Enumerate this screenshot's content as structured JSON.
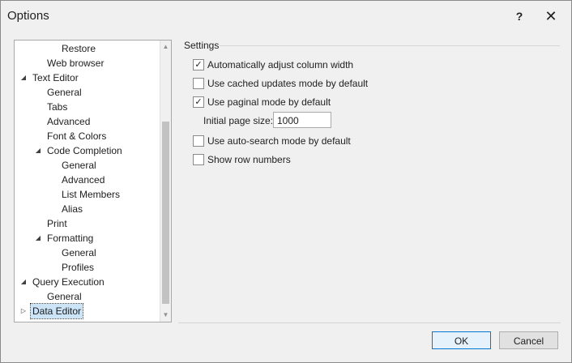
{
  "window": {
    "title": "Options",
    "help_glyph": "?",
    "close_glyph": "✕"
  },
  "tree": {
    "items": [
      {
        "label": "Restore",
        "level": 3,
        "expander": ""
      },
      {
        "label": "Web browser",
        "level": 2,
        "expander": ""
      },
      {
        "label": "Text Editor",
        "level": 1,
        "expander": "◢"
      },
      {
        "label": "General",
        "level": 2,
        "expander": ""
      },
      {
        "label": "Tabs",
        "level": 2,
        "expander": ""
      },
      {
        "label": "Advanced",
        "level": 2,
        "expander": ""
      },
      {
        "label": "Font & Colors",
        "level": 2,
        "expander": ""
      },
      {
        "label": "Code Completion",
        "level": 2,
        "expander": "◢"
      },
      {
        "label": "General",
        "level": 3,
        "expander": ""
      },
      {
        "label": "Advanced",
        "level": 3,
        "expander": ""
      },
      {
        "label": "List Members",
        "level": 3,
        "expander": ""
      },
      {
        "label": "Alias",
        "level": 3,
        "expander": ""
      },
      {
        "label": "Print",
        "level": 2,
        "expander": ""
      },
      {
        "label": "Formatting",
        "level": 2,
        "expander": "◢"
      },
      {
        "label": "General",
        "level": 3,
        "expander": ""
      },
      {
        "label": "Profiles",
        "level": 3,
        "expander": ""
      },
      {
        "label": "Query Execution",
        "level": 1,
        "expander": "◢"
      },
      {
        "label": "General",
        "level": 2,
        "expander": ""
      },
      {
        "label": "Data Editor",
        "level": 1,
        "expander": "▷",
        "selected": true
      }
    ]
  },
  "settings": {
    "group_label": "Settings",
    "options": [
      {
        "label": "Automatically adjust column width",
        "checked": true
      },
      {
        "label": "Use cached updates mode by default",
        "checked": false
      },
      {
        "label": "Use paginal mode by default",
        "checked": true
      },
      {
        "label": "Use auto-search mode by default",
        "checked": false
      },
      {
        "label": "Show row numbers",
        "checked": false
      }
    ],
    "page_size_label": "Initial page size:",
    "page_size_value": "1000"
  },
  "buttons": {
    "ok": "OK",
    "cancel": "Cancel"
  }
}
